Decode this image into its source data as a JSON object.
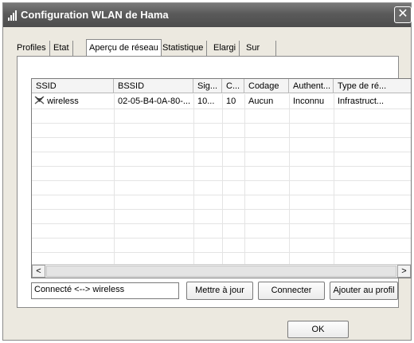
{
  "window": {
    "title": "Configuration WLAN de Hama",
    "close_glyph": "✕"
  },
  "tabs": [
    {
      "label": "Profiles"
    },
    {
      "label": "Etat"
    },
    {
      "label": "Aperçu de réseau",
      "active": true
    },
    {
      "label": "Statistique"
    },
    {
      "label": "Elargi"
    },
    {
      "label": "Sur"
    }
  ],
  "network_list": {
    "columns": [
      "SSID",
      "BSSID",
      "Sig...",
      "C...",
      "Codage",
      "Authent...",
      "Type de ré..."
    ],
    "rows": [
      {
        "icon": "wireless-network-icon",
        "ssid": "wireless",
        "bssid": "02-05-B4-0A-80-...",
        "signal": "10...",
        "channel": "10",
        "encryption": "Aucun",
        "authentication": "Inconnu",
        "network_type": "Infrastruct..."
      }
    ],
    "scroll_left": "<",
    "scroll_right": ">"
  },
  "status": {
    "text": "Connecté <--> wireless"
  },
  "buttons": {
    "refresh": "Mettre à jour",
    "connect": "Connecter",
    "add_profile": "Ajouter au profil",
    "ok": "OK"
  }
}
